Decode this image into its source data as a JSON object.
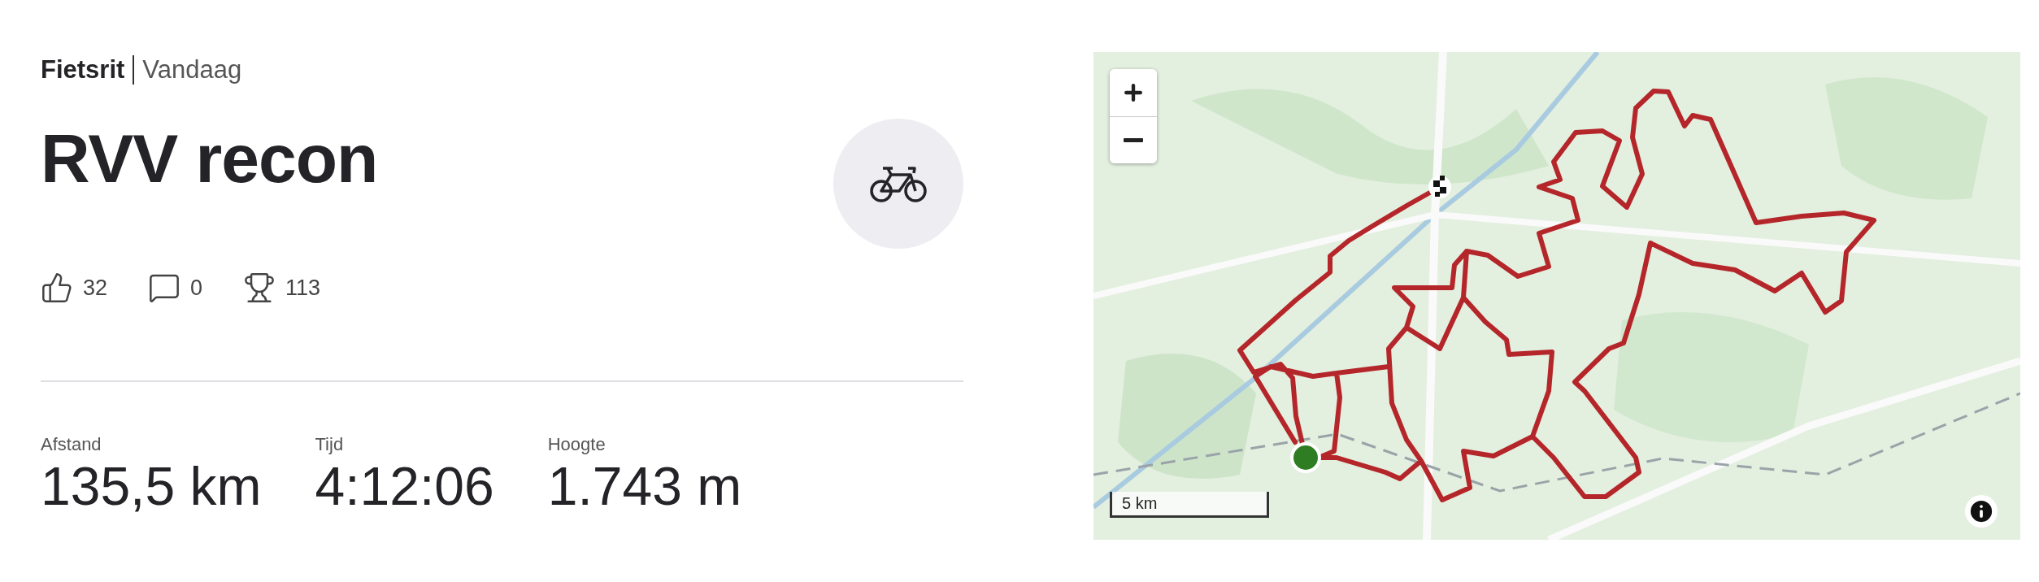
{
  "activity": {
    "type": "Fietsrit",
    "date": "Vandaag",
    "title": "RVV recon",
    "kind": "bike"
  },
  "social": [
    {
      "kind": "kudos",
      "count": "32"
    },
    {
      "kind": "comments",
      "count": "0"
    },
    {
      "kind": "achievements",
      "count": "113"
    }
  ],
  "stats": [
    {
      "label": "Afstand",
      "value": "135,5 km"
    },
    {
      "label": "Tijd",
      "value": "4:12:06"
    },
    {
      "label": "Hoogte",
      "value": "1.743 m"
    }
  ],
  "map": {
    "kind": "picture",
    "scale": "5 km"
  }
}
